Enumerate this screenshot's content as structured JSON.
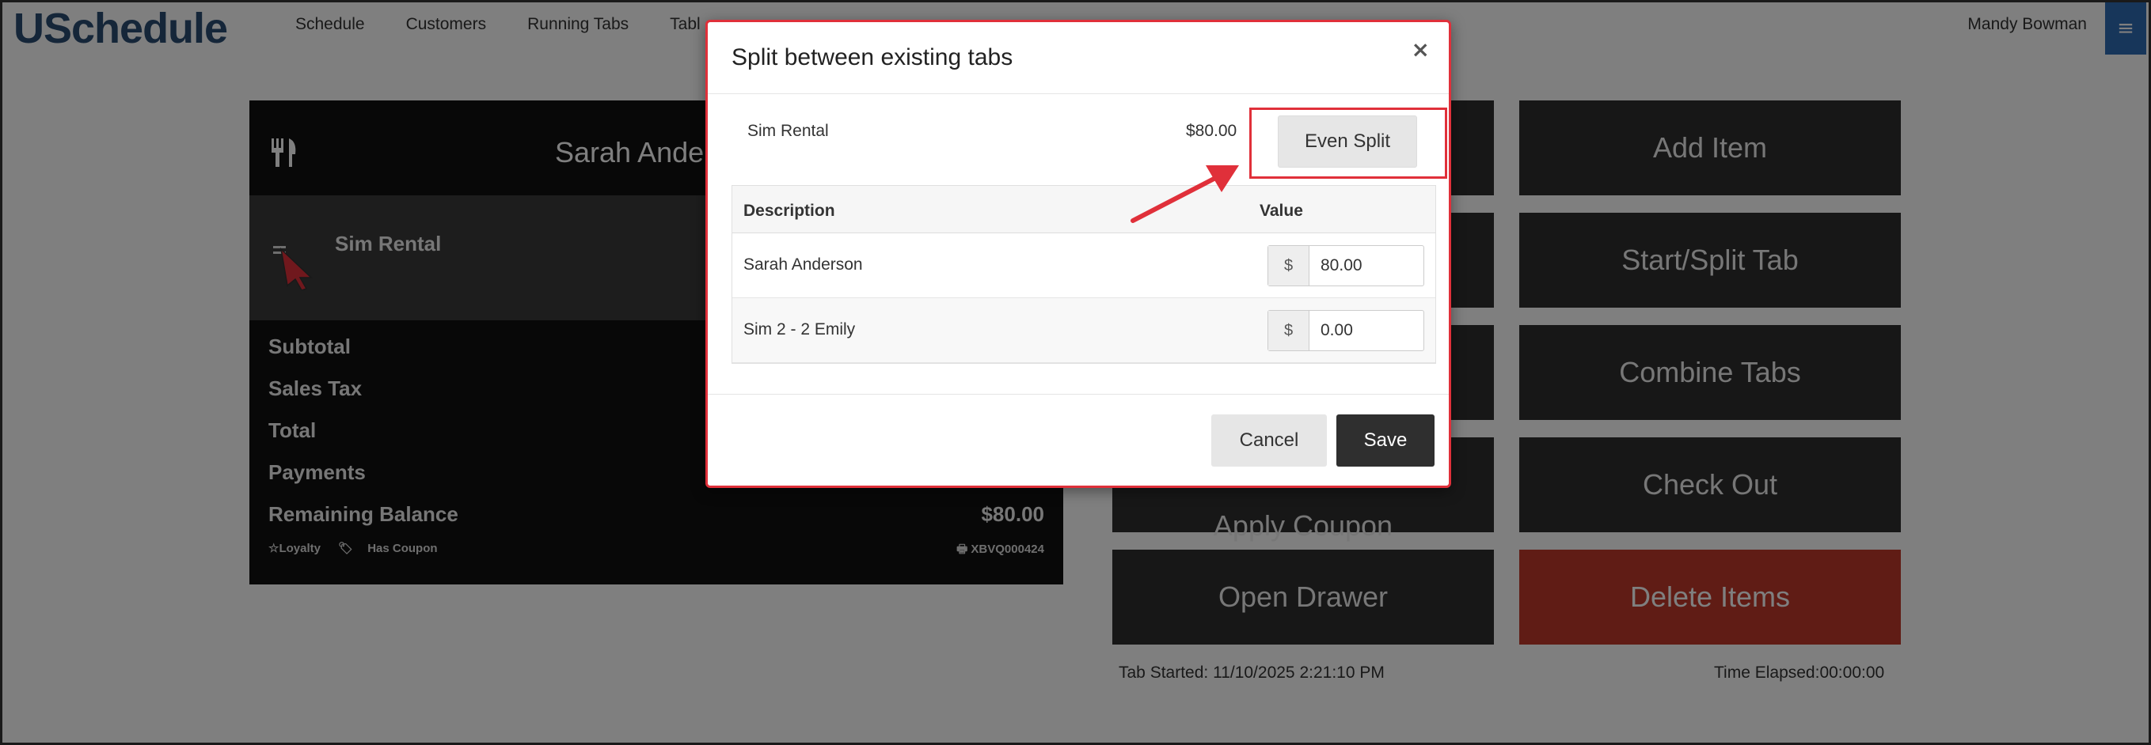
{
  "navbar": {
    "brand": "USchedule",
    "links": [
      "Schedule",
      "Customers",
      "Running Tabs",
      "Tabl"
    ],
    "user": "Mandy Bowman",
    "menu_icon": "hamburger-icon"
  },
  "tab": {
    "customer_name": "Sarah Ander",
    "item_name": "Sim Rental",
    "summary": [
      {
        "label": "Subtotal",
        "value": ""
      },
      {
        "label": "Sales Tax",
        "value": ""
      },
      {
        "label": "Total",
        "value": ""
      },
      {
        "label": "Payments",
        "value": ""
      },
      {
        "label": "Remaining Balance",
        "value": "$80.00"
      }
    ],
    "tags": [
      "☆Loyalty",
      "Has Coupon"
    ],
    "tab_code": "XBVQ000424"
  },
  "actions": {
    "add_item": "Add Item",
    "start_split": "Start/Split Tab",
    "combine": "Combine Tabs",
    "check_out": "Check Out",
    "open_drawer": "Open Drawer",
    "delete_items": "Delete Items",
    "apply_coupon": "Apply Coupon"
  },
  "footer": {
    "tab_started": "Tab Started: 11/10/2025 2:21:10 PM",
    "time_elapsed": "Time Elapsed:00:00:00"
  },
  "modal": {
    "title": "Split between existing tabs",
    "close": "×",
    "item_name": "Sim Rental",
    "item_price": "$80.00",
    "even_split_label": "Even Split",
    "columns": [
      "Description",
      "Value"
    ],
    "rows": [
      {
        "name": "Sarah Anderson",
        "currency": "$",
        "value": "80.00"
      },
      {
        "name": "Sim 2 - 2 Emily",
        "currency": "$",
        "value": "0.00"
      }
    ],
    "cancel_label": "Cancel",
    "save_label": "Save"
  },
  "colors": {
    "brand": "#2a4d73",
    "danger": "#c0392b",
    "annotation": "#e0303a",
    "menu": "#2f6db5"
  }
}
